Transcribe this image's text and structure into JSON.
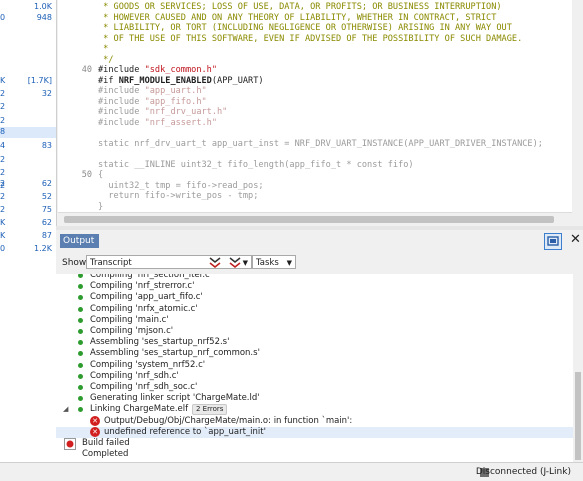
{
  "left_pane": {
    "rows": [
      {
        "c1": "",
        "c2": "1.0K"
      },
      {
        "c1": "0",
        "c2": "948"
      },
      {
        "c1": "",
        "c2": ""
      },
      {
        "c1": "",
        "c2": ""
      },
      {
        "c1": "",
        "c2": ""
      },
      {
        "c1": "",
        "c2": ""
      },
      {
        "c1": "K]",
        "c2": "[1.7K]"
      },
      {
        "c1": "2",
        "c2": "32"
      },
      {
        "c1": "2",
        "c2": ""
      },
      {
        "c1": "2",
        "c2": ""
      },
      {
        "c1": "8",
        "c2": ""
      },
      {
        "c1": "4",
        "c2": "83"
      },
      {
        "c1": "2",
        "c2": ""
      },
      {
        "c1": "2",
        "c2": ""
      },
      {
        "c1": "2",
        "c2": ""
      },
      {
        "c1": "2",
        "c2": "62"
      },
      {
        "c1": "2",
        "c2": "52"
      },
      {
        "c1": "2",
        "c2": "75"
      },
      {
        "c1": "K",
        "c2": "62"
      },
      {
        "c1": "K",
        "c2": "87"
      },
      {
        "c1": "0",
        "c2": "1.2K"
      }
    ]
  },
  "editor": {
    "lines": [
      {
        "n": "",
        "text": " * GOODS OR SERVICES; LOSS OF USE, DATA, OR PROFITS; OR BUSINESS INTERRUPTION)",
        "cls": "cm"
      },
      {
        "n": "",
        "text": " * HOWEVER CAUSED AND ON ANY THEORY OF LIABILITY, WHETHER IN CONTRACT, STRICT",
        "cls": "cm"
      },
      {
        "n": "",
        "text": " * LIABILITY, OR TORT (INCLUDING NEGLIGENCE OR OTHERWISE) ARISING IN ANY WAY OUT",
        "cls": "cm"
      },
      {
        "n": "",
        "text": " * OF THE USE OF THIS SOFTWARE, EVEN IF ADVISED OF THE POSSIBILITY OF SUCH DAMAGE.",
        "cls": "cm"
      },
      {
        "n": "",
        "text": " *",
        "cls": "cm"
      },
      {
        "n": "",
        "text": " */",
        "cls": "cm"
      },
      {
        "n": "40",
        "pre": "#include ",
        "str": "\"sdk_common.h\"",
        "cls": "pp",
        "scls": "str"
      },
      {
        "n": "",
        "pre": "#if ",
        "bold": "NRF_MODULE_ENABLED",
        "post": "(APP_UART)",
        "cls": "pp"
      },
      {
        "n": "",
        "pre": "#include ",
        "str": "\"app_uart.h\"",
        "cls": "ghost",
        "scls": "ghoststr"
      },
      {
        "n": "",
        "pre": "#include ",
        "str": "\"app_fifo.h\"",
        "cls": "ghost",
        "scls": "ghoststr"
      },
      {
        "n": "",
        "pre": "#include ",
        "str": "\"nrf_drv_uart.h\"",
        "cls": "ghost",
        "scls": "ghoststr"
      },
      {
        "n": "",
        "pre": "#include ",
        "str": "\"nrf_assert.h\"",
        "cls": "ghost",
        "scls": "ghoststr"
      },
      {
        "n": "",
        "text": "",
        "cls": "pp"
      },
      {
        "n": "",
        "text": "static nrf_drv_uart_t app_uart_inst = NRF_DRV_UART_INSTANCE(APP_UART_DRIVER_INSTANCE);",
        "cls": "ghost"
      },
      {
        "n": "",
        "text": "",
        "cls": "pp"
      },
      {
        "n": "",
        "text": "static __INLINE uint32_t fifo_length(app_fifo_t * const fifo)",
        "cls": "ghost"
      },
      {
        "n": "50",
        "text": "{",
        "cls": "ghost"
      },
      {
        "n": "",
        "text": "  uint32_t tmp = fifo->read_pos;",
        "cls": "ghost"
      },
      {
        "n": "",
        "text": "  return fifo->write_pos - tmp;",
        "cls": "ghost"
      },
      {
        "n": "",
        "text": "}",
        "cls": "ghost"
      }
    ]
  },
  "output": {
    "tab_label": "Output",
    "show_label": "Show:",
    "show_value": "Transcript",
    "tasks_value": "Tasks",
    "items": [
      {
        "kind": "bullet",
        "text": "Compiling 'nrf_section_iter.c'"
      },
      {
        "kind": "bullet",
        "text": "Compiling 'nrf_strerror.c'"
      },
      {
        "kind": "bullet",
        "text": "Compiling 'app_uart_fifo.c'"
      },
      {
        "kind": "bullet",
        "text": "Compiling 'nrfx_atomic.c'"
      },
      {
        "kind": "bullet",
        "text": "Compiling 'main.c'"
      },
      {
        "kind": "bullet",
        "text": "Compiling 'mjson.c'"
      },
      {
        "kind": "bullet",
        "text": "Assembling 'ses_startup_nrf52.s'"
      },
      {
        "kind": "bullet",
        "text": "Assembling 'ses_startup_nrf_common.s'"
      },
      {
        "kind": "bullet",
        "text": "Compiling 'system_nrf52.c'"
      },
      {
        "kind": "bullet",
        "text": "Compiling 'nrf_sdh.c'"
      },
      {
        "kind": "bullet",
        "text": "Compiling 'nrf_sdh_soc.c'"
      },
      {
        "kind": "bullet",
        "text": "Generating linker script 'ChargeMate.ld'"
      },
      {
        "kind": "parent",
        "text": "Linking ChargeMate.elf",
        "badge": "2 Errors"
      },
      {
        "kind": "error",
        "text": "Output/Debug/Obj/ChargeMate/main.o: in function `main':"
      },
      {
        "kind": "error",
        "text": "undefined reference to `app_uart_init'",
        "selected": true
      },
      {
        "kind": "failed",
        "text": "Build failed"
      },
      {
        "kind": "plain",
        "text": "Completed"
      }
    ]
  },
  "status": {
    "text": "Disconnected (J-Link)"
  }
}
